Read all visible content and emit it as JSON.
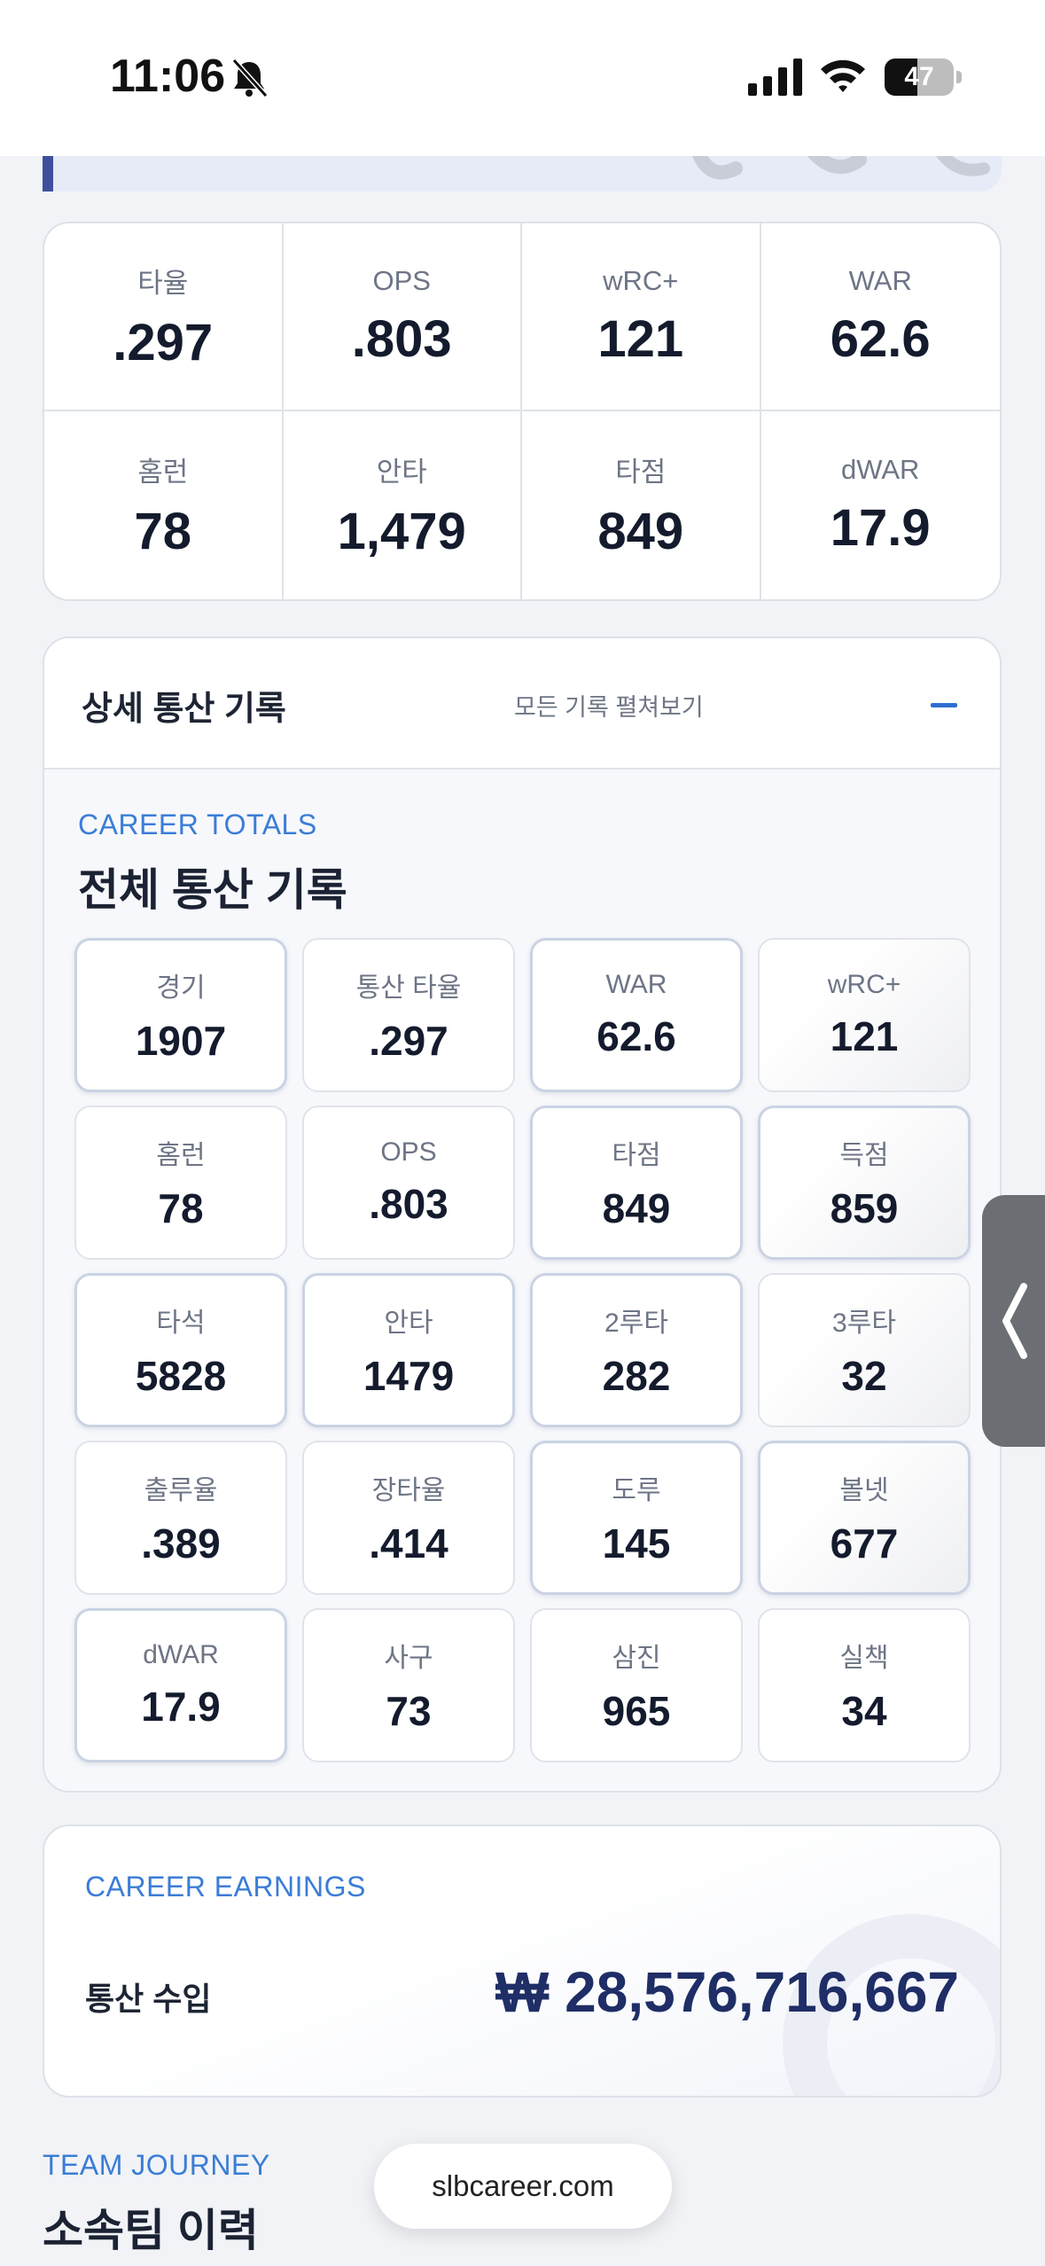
{
  "status_bar": {
    "time": "11:06",
    "battery_text": "47",
    "battery_level": 0.47,
    "icons": [
      "bell-slash-icon",
      "cellular-signal-icon",
      "wifi-icon",
      "battery-icon"
    ]
  },
  "summary": {
    "stats": [
      {
        "label": "타율",
        "value": ".297"
      },
      {
        "label": "OPS",
        "value": ".803"
      },
      {
        "label": "wRC+",
        "value": "121"
      },
      {
        "label": "WAR",
        "value": "62.6"
      },
      {
        "label": "홈런",
        "value": "78"
      },
      {
        "label": "안타",
        "value": "1,479"
      },
      {
        "label": "타점",
        "value": "849"
      },
      {
        "label": "dWAR",
        "value": "17.9"
      }
    ]
  },
  "detail": {
    "title": "상세 통산 기록",
    "expand_all": "모든 기록 펼쳐보기",
    "eyebrow": "CAREER TOTALS",
    "section_title": "전체 통산 기록",
    "totals": [
      {
        "label": "경기",
        "value": "1907"
      },
      {
        "label": "통산 타율",
        "value": ".297"
      },
      {
        "label": "WAR",
        "value": "62.6"
      },
      {
        "label": "wRC+",
        "value": "121"
      },
      {
        "label": "홈런",
        "value": "78"
      },
      {
        "label": "OPS",
        "value": ".803"
      },
      {
        "label": "타점",
        "value": "849"
      },
      {
        "label": "득점",
        "value": "859"
      },
      {
        "label": "타석",
        "value": "5828"
      },
      {
        "label": "안타",
        "value": "1479"
      },
      {
        "label": "2루타",
        "value": "282"
      },
      {
        "label": "3루타",
        "value": "32"
      },
      {
        "label": "출루율",
        "value": ".389"
      },
      {
        "label": "장타율",
        "value": ".414"
      },
      {
        "label": "도루",
        "value": "145"
      },
      {
        "label": "볼넷",
        "value": "677"
      },
      {
        "label": "dWAR",
        "value": "17.9"
      },
      {
        "label": "사구",
        "value": "73"
      },
      {
        "label": "삼진",
        "value": "965"
      },
      {
        "label": "실책",
        "value": "34"
      }
    ]
  },
  "earnings": {
    "eyebrow": "CAREER EARNINGS",
    "label": "통산 수입",
    "value": "₩ 28,576,716,667"
  },
  "team": {
    "eyebrow": "TEAM JOURNEY",
    "title": "소속팀 이력"
  },
  "url_bar": {
    "domain": "slbcareer.com"
  },
  "colors": {
    "accent_blue": "#3b7dd6",
    "navy": "#1f2e66",
    "page_bg": "#f1f3f7"
  }
}
